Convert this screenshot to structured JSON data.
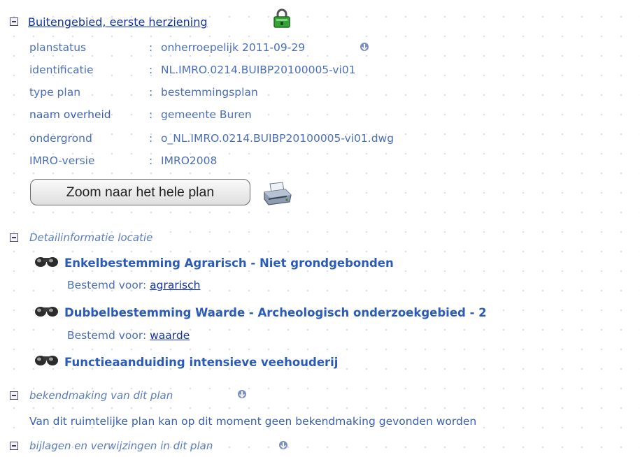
{
  "plan": {
    "title": "Buitengebied, eerste herziening",
    "lock_icon": "green-padlock-icon",
    "properties": [
      {
        "label": "planstatus",
        "value": "onherroepelijk 2011-09-29"
      },
      {
        "label": "identificatie",
        "value": "NL.IMRO.0214.BUIBP20100005-vi01"
      },
      {
        "label": "type plan",
        "value": "bestemmingsplan"
      },
      {
        "label": "naam overheid",
        "value": "gemeente Buren"
      },
      {
        "label": "ondergrond",
        "value": "o_NL.IMRO.0214.BUIBP20100005-vi01.dwg"
      },
      {
        "label": "IMRO-versie",
        "value": "IMRO2008"
      }
    ],
    "separator": ":",
    "zoom_button": "Zoom naar het hele plan",
    "print_icon": "printer-icon"
  },
  "detail": {
    "title": "Detailinformatie locatie",
    "items": [
      {
        "title": "Enkelbestemming Agrarisch - Niet grondgebonden",
        "bestemd_label": "Bestemd voor:",
        "bestemd_link": "agrarisch"
      },
      {
        "title": "Dubbelbestemming Waarde - Archeologisch onderzoekgebied - 2",
        "bestemd_label": "Bestemd voor:",
        "bestemd_link": "waarde"
      },
      {
        "title": "Functieaanduiding intensieve veehouderij"
      }
    ]
  },
  "bekendmaking": {
    "title": "bekendmaking van dit plan",
    "text": "Van dit ruimtelijke plan kan op dit moment geen bekendmaking gevonden worden"
  },
  "bijlagen": {
    "title": "bijlagen en verwijzingen in dit plan"
  },
  "colors": {
    "link": "#1133aa",
    "text": "#4a6fbb",
    "heading": "#2b5bb8",
    "lock": "#2f9a2f"
  }
}
